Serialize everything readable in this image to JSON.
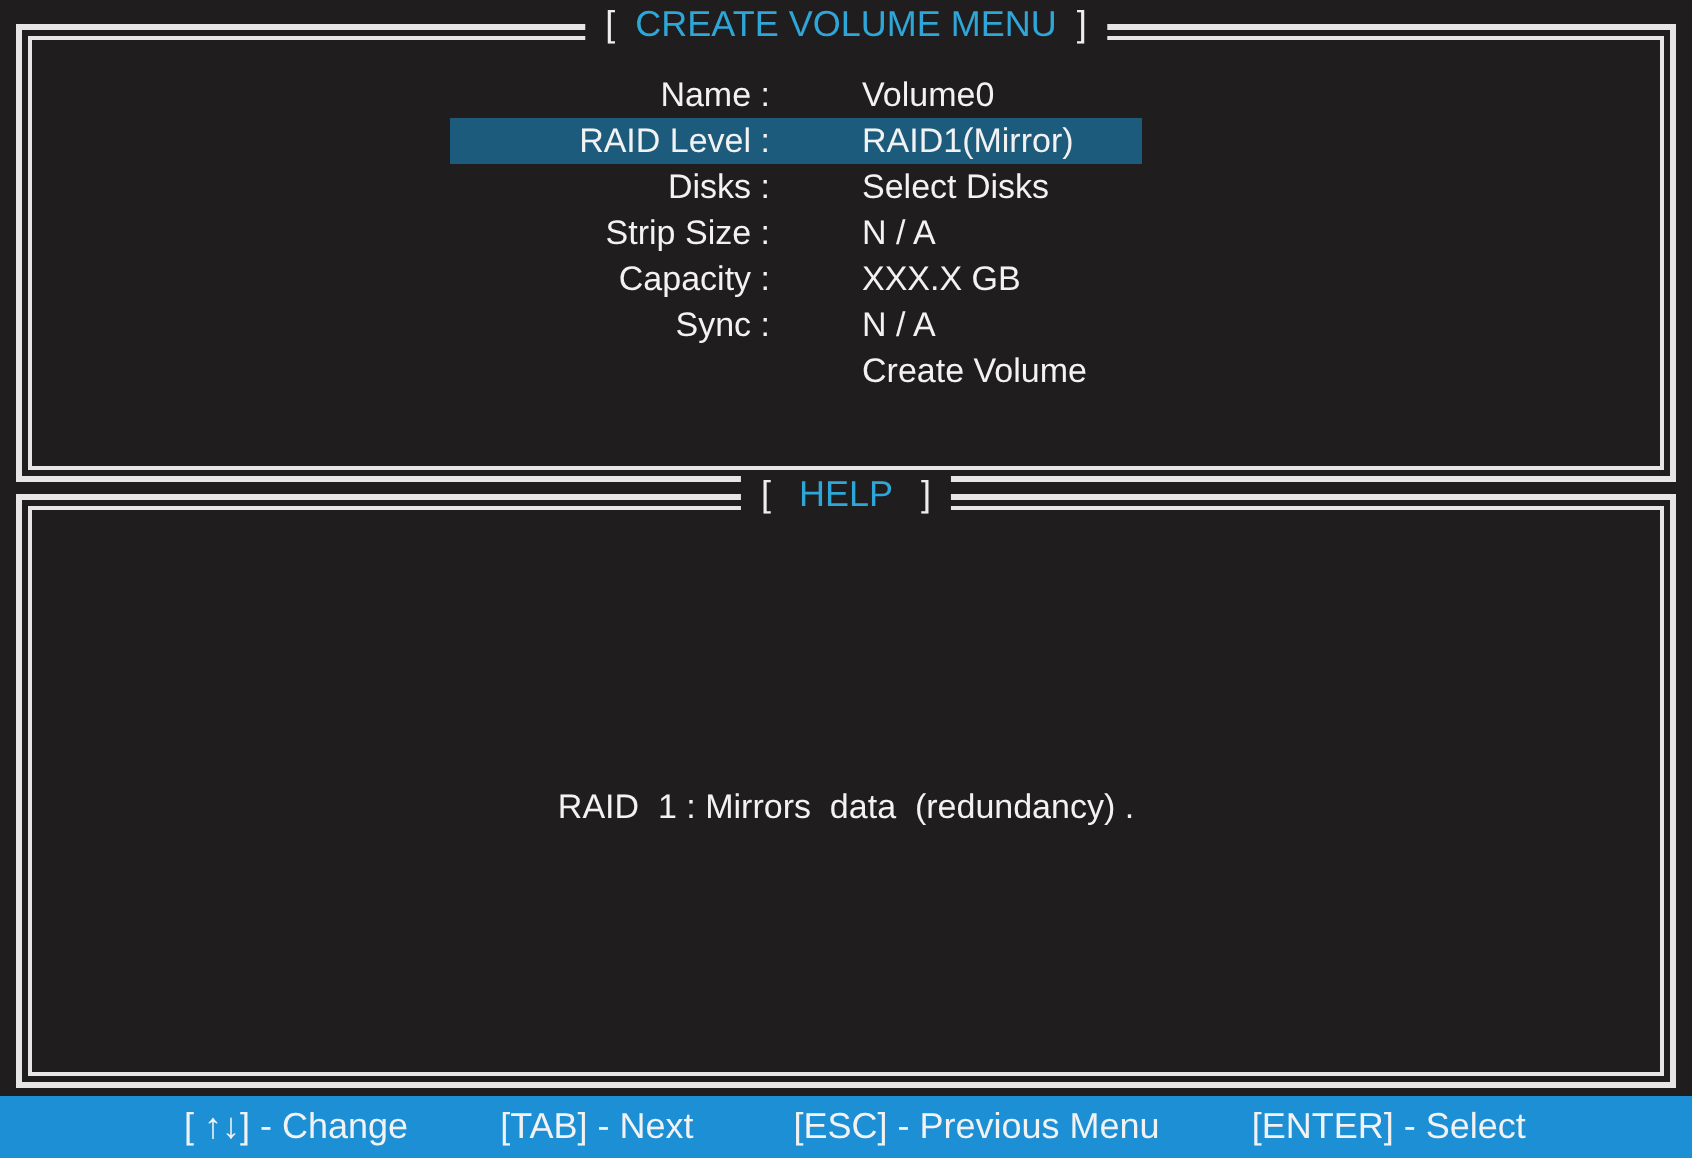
{
  "create_volume_menu": {
    "bracket_open": "[",
    "title": "CREATE VOLUME MENU",
    "bracket_close": "]",
    "fields": [
      {
        "label": "Name :",
        "value": "Volume0",
        "selected": false
      },
      {
        "label": "RAID Level :",
        "value": "RAID1(Mirror)",
        "selected": true
      },
      {
        "label": "Disks :",
        "value": "Select  Disks",
        "selected": false
      },
      {
        "label": "Strip Size :",
        "value": "N / A",
        "selected": false
      },
      {
        "label": "Capacity :",
        "value": "XXX.X  GB",
        "selected": false
      },
      {
        "label": "Sync :",
        "value": "N / A",
        "selected": false
      },
      {
        "value": "Create Volume",
        "selected": false
      }
    ]
  },
  "help": {
    "bracket_open": "[",
    "title": "HELP",
    "bracket_close": "]",
    "text": "RAID  1 : Mirrors  data  (redundancy) ."
  },
  "status_bar": [
    "[ ↑↓] - Change",
    "[TAB] - Next",
    "[ESC] - Previous Menu",
    "[ENTER] - Select"
  ]
}
